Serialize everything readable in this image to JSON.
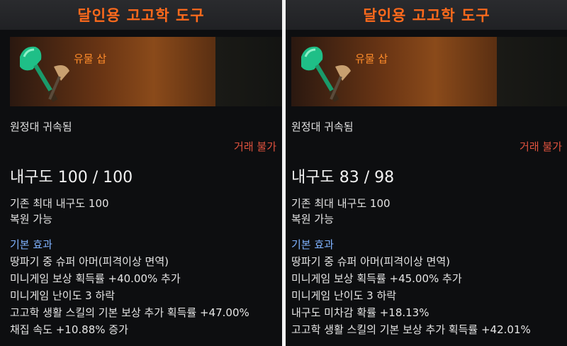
{
  "colors": {
    "title": "#ff6a1c",
    "item_name": "#ff8c2a",
    "trade": "#e0523e",
    "section": "#7fb2ff"
  },
  "left": {
    "title": "달인용 고고학 도구",
    "item_name": "유물 삽",
    "bound": "원정대 귀속됨",
    "trade": "거래 불가",
    "durability": "내구도 100 / 100",
    "max_durability": "기존 최대 내구도 100",
    "restore": "복원 가능",
    "section": "기본 효과",
    "effects": [
      "땅파기 중 슈퍼 아머(피격이상 면역)",
      "미니게임 보상 획득률 +40.00% 추가",
      "미니게임 난이도 3 하락",
      "고고학 생활 스킬의 기본 보상 추가 획득률 +47.00%",
      "채집 속도 +10.88% 증가"
    ]
  },
  "right": {
    "title": "달인용 고고학 도구",
    "item_name": "유물 삽",
    "bound": "원정대 귀속됨",
    "trade": "거래 불가",
    "durability": "내구도 83 / 98",
    "max_durability": "기존 최대 내구도 100",
    "restore": "복원 가능",
    "section": "기본 효과",
    "effects": [
      "땅파기 중 슈퍼 아머(피격이상 면역)",
      "미니게임 보상 획득률 +45.00% 추가",
      "미니게임 난이도 3 하락",
      "내구도 미차감 확률 +18.13%",
      "고고학 생활 스킬의 기본 보상 추가 획득률 +42.01%"
    ]
  }
}
